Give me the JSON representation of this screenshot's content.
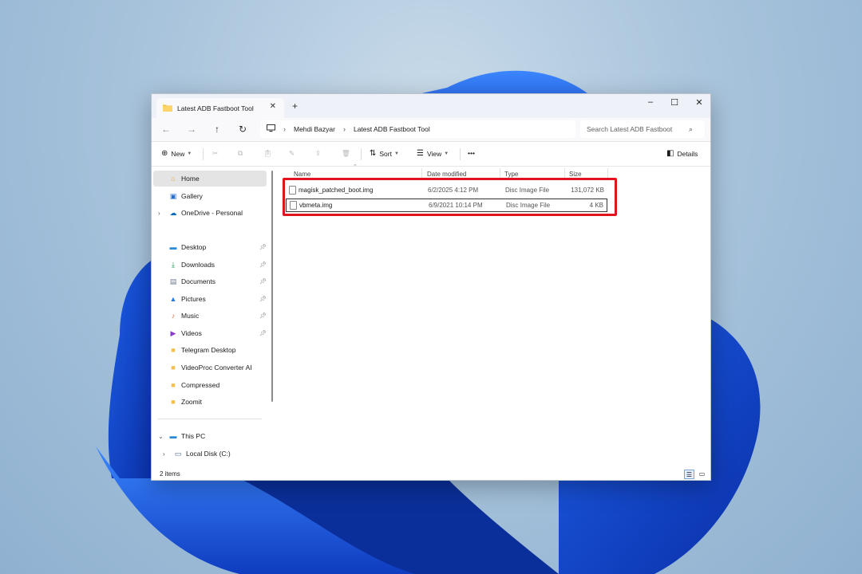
{
  "window": {
    "tab_title": "Latest ADB Fastboot Tool",
    "new_tab_label": "+",
    "controls": {
      "minimize": "–",
      "maximize": "☐",
      "close": "✕"
    }
  },
  "address": {
    "breadcrumb": [
      "Mehdi Bazyar",
      "Latest ADB Fastboot Tool"
    ],
    "search_placeholder": "Search Latest ADB Fastboot"
  },
  "toolbar": {
    "new_label": "New",
    "sort_label": "Sort",
    "view_label": "View",
    "more_label": "•••",
    "details_label": "Details"
  },
  "sidebar": {
    "top_items": [
      {
        "label": "Home",
        "icon": "home-icon"
      },
      {
        "label": "Gallery",
        "icon": "gallery-icon"
      },
      {
        "label": "OneDrive - Personal",
        "icon": "cloud-icon"
      }
    ],
    "pinned_items": [
      {
        "label": "Desktop",
        "icon": "desktop-icon"
      },
      {
        "label": "Downloads",
        "icon": "download-icon"
      },
      {
        "label": "Documents",
        "icon": "document-icon"
      },
      {
        "label": "Pictures",
        "icon": "pictures-icon"
      },
      {
        "label": "Music",
        "icon": "music-icon"
      },
      {
        "label": "Videos",
        "icon": "videos-icon"
      }
    ],
    "folders": [
      {
        "label": "Telegram Desktop"
      },
      {
        "label": "VideoProc Converter AI"
      },
      {
        "label": "Compressed"
      },
      {
        "label": "Zoomit"
      }
    ],
    "this_pc": {
      "label": "This PC"
    },
    "local_disk": {
      "label": "Local Disk (C:)"
    }
  },
  "file_list": {
    "columns": [
      "Name",
      "Date modified",
      "Type",
      "Size"
    ],
    "rows": [
      {
        "name": "magisk_patched_boot.img",
        "date": "6/2/2025 4:12 PM",
        "type": "Disc Image File",
        "size": "131,072 KB"
      },
      {
        "name": "vbmeta.img",
        "date": "6/9/2021 10:14 PM",
        "type": "Disc Image File",
        "size": "4 KB"
      }
    ]
  },
  "status": {
    "item_count": "2 items"
  },
  "colors": {
    "highlight": "#e0141e",
    "accent": "#0067c0",
    "folder": "#f5c04a"
  }
}
